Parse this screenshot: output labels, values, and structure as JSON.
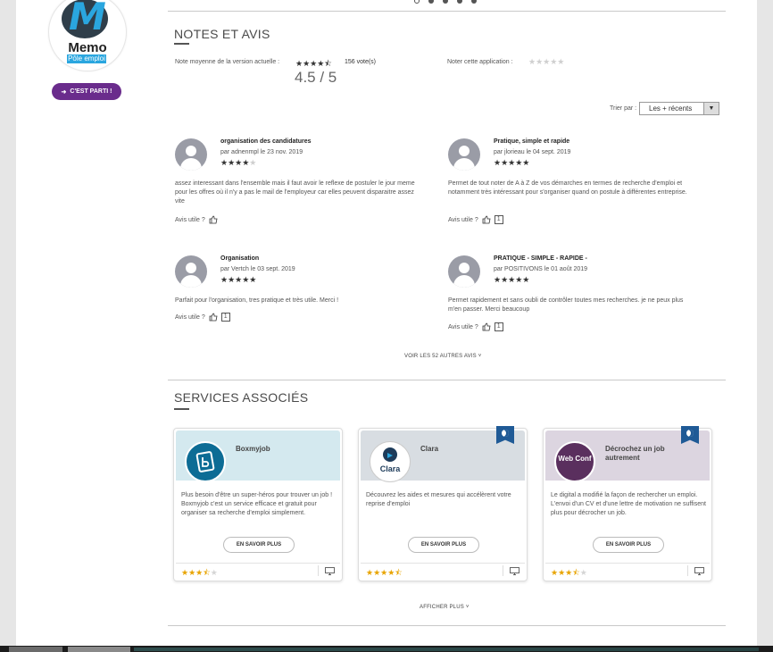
{
  "app": {
    "logo_word": "Memo",
    "logo_sub": "Pôle emploi",
    "cta_label": "C'EST PARTI !"
  },
  "carousel": {
    "dots": 5,
    "active": 0
  },
  "ratings": {
    "section_title": "NOTES ET AVIS",
    "avg_label": "Note moyenne de la version actuelle :",
    "avg_stars": 4.5,
    "votes": "156 vote(s)",
    "avg_score": "4.5 / 5",
    "rate_label": "Noter cette application :",
    "sort_label": "Trier par :",
    "sort_value": "Les + récents",
    "useful_label": "Avis utile ?",
    "more_reviews": "VOIR LES 52 AUTRES AVIS"
  },
  "reviews": [
    {
      "title": "organisation des candidatures",
      "author": "par adnenmpl le 23 nov. 2019",
      "stars": 4,
      "text": "assez interessant dans l'ensemble mais il faut avoir le reflexe de postuler le jour meme pour les offres où il n'y a pas le mail de l'employeur car elles peuvent disparaitre assez vite",
      "useful_count": ""
    },
    {
      "title": "Pratique, simple et rapide",
      "author": "par jlorieau le 04 sept. 2019",
      "stars": 5,
      "text": "Permet de tout noter de A à Z de vos démarches en termes de recherche d'emploi et notamment très intéressant pour s'organiser quand on postule à différentes entreprise.",
      "useful_count": "1"
    },
    {
      "title": "Organisation",
      "author": "par Vertch le 03 sept. 2019",
      "stars": 5,
      "text": "Parfait pour l'organisation, tres pratique et très utile. Merci !",
      "useful_count": "1"
    },
    {
      "title": "PRATIQUE - SIMPLE - RAPIDE -",
      "author": "par POSITIVONS le 01 août 2019",
      "stars": 5,
      "text": "Permet rapidement et sans oubli de contrôler toutes mes recherches. je ne peux plus m'en passer. Merci beaucoup",
      "useful_count": "1"
    }
  ],
  "services": {
    "section_title": "SERVICES ASSOCIÉS",
    "button_label": "EN SAVOIR PLUS",
    "more_label": "AFFICHER PLUS",
    "items": [
      {
        "name": "Boxmyjob",
        "desc": "Plus besoin d'être un super-héros pour trouver un job ! Boxmyjob c'est un service efficace et gratuit pour organiser sa recherche d'emploi simplement.",
        "stars": 3.5,
        "banner_color": "#d4e9ef",
        "logo_color": "#0d6c95",
        "badge": false,
        "logo_text": ""
      },
      {
        "name": "Clara",
        "desc": "Découvrez les aides et mesures qui accélèrent votre reprise d'emploi",
        "stars": 4.5,
        "banner_color": "#d8dde2",
        "logo_color": "#ffffff",
        "badge": true,
        "logo_text": "Clara"
      },
      {
        "name": "Décrochez un job autrement",
        "desc": "Le digital a modifié la façon de rechercher un emploi. L'envoi d'un CV et d'une lettre de motivation ne suffisent plus pour décrocher un job.",
        "stars": 3.5,
        "banner_color": "#dcd5e0",
        "logo_color": "#5a2f5e",
        "badge": true,
        "logo_text": "Web Conf"
      }
    ]
  }
}
